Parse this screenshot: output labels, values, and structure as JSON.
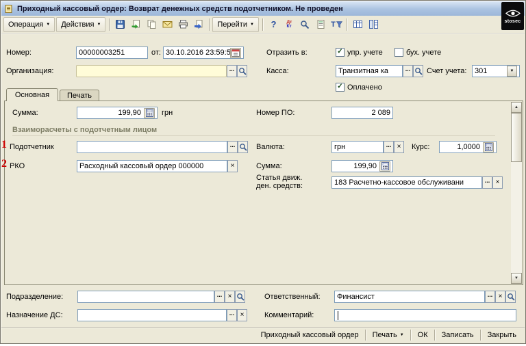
{
  "window": {
    "title": "Приходный кассовый ордер: Возврат денежных средств подотчетником. Не проведен",
    "logo_text": "stosec"
  },
  "toolbar": {
    "operation_label": "Операция",
    "actions_label": "Действия",
    "goto_label": "Перейти",
    "help_label": "?",
    "dt_label": "Дт",
    "kt_label": "Кт",
    "filter_label": "Т"
  },
  "icons": {
    "dropdown": "▼",
    "ellipsis": "...",
    "clear": "×",
    "check": "✓",
    "scroll_up": "▲",
    "scroll_down": "▼"
  },
  "header": {
    "number_label": "Номер:",
    "number_value": "00000003251",
    "date_label": "от:",
    "date_value": "30.10.2016 23:59:5",
    "reflect_label": "Отразить в:",
    "mgmt_acct_label": "упр. учете",
    "acc_acct_label": "бух. учете",
    "org_label": "Организация:",
    "org_value": "",
    "cash_label": "Касса:",
    "cash_value": "Транзитная ка",
    "account_label": "Счет учета:",
    "account_value": "301",
    "paid_label": "Оплачено"
  },
  "tabs": {
    "main_label": "Основная",
    "print_label": "Печать"
  },
  "main": {
    "sum_label": "Сумма:",
    "sum_value": "199,90",
    "sum_currency": "грн",
    "po_number_label": "Номер ПО:",
    "po_number_value": "2 089",
    "section_title": "Взаиморасчеты с подотчетным лицом",
    "marker1": "1",
    "accountable_label": "Подотчетник",
    "accountable_value": "",
    "currency_label": "Валюта:",
    "currency_value": "грн",
    "rate_label": "Курс:",
    "rate_value": "1,0000",
    "marker2": "2",
    "rko_label": "РКО",
    "rko_value": "Расходный кассовый ордер 000000",
    "sum2_label": "Сумма:",
    "sum2_value": "199,90",
    "cashflow_label1": "Статья движ.",
    "cashflow_label2": "ден. средств:",
    "cashflow_value": "183 Расчетно-кассовое обслуживани"
  },
  "footer": {
    "division_label": "Подразделение:",
    "division_value": "",
    "responsible_label": "Ответственный:",
    "responsible_value": "Финансист",
    "purpose_label": "Назначение ДС:",
    "purpose_value": "",
    "comment_label": "Комментарий:",
    "comment_value": ""
  },
  "bottom_bar": {
    "doc_label": "Приходный кассовый ордер",
    "print_label": "Печать",
    "ok_label": "ОК",
    "save_label": "Записать",
    "close_label": "Закрыть"
  }
}
